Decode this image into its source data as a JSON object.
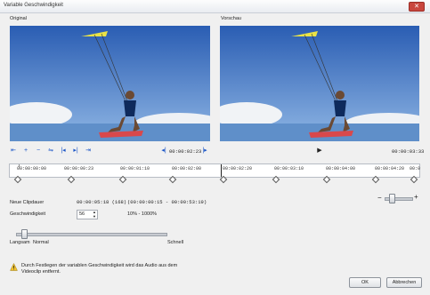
{
  "window": {
    "title": "Variable Geschwindigkeit",
    "close_icon": "close-icon"
  },
  "panels": {
    "original_label": "Original",
    "preview_label": "Vorschau"
  },
  "transport": {
    "buttons": [
      {
        "name": "mark-in-icon",
        "glyph": "⇤"
      },
      {
        "name": "add-keyframe-icon",
        "glyph": "+"
      },
      {
        "name": "remove-keyframe-icon",
        "glyph": "−"
      },
      {
        "name": "reverse-keyframe-icon",
        "glyph": "⇋"
      },
      {
        "name": "prev-keyframe-icon",
        "glyph": "|◂"
      },
      {
        "name": "next-keyframe-icon",
        "glyph": "▸|"
      },
      {
        "name": "mark-out-icon",
        "glyph": "⇥"
      }
    ],
    "left_timecode": "00:00:02:23",
    "right_timecode": "00:00:03:33",
    "prev_frame_glyph": "◂|",
    "next_frame_glyph": "|▸",
    "play_glyph": "▶"
  },
  "timeline": {
    "labels": [
      "00:00:00:00",
      "00:00:00:23",
      "00:00:01:10",
      "00:00:02:00",
      "00:00:02:20",
      "00:00:03:10",
      "00:00:04:00",
      "00:00:04:20",
      "00:0"
    ]
  },
  "zoom": {
    "minus": "−",
    "plus": "+",
    "level": 0.25
  },
  "clip": {
    "neue_clipdauer_label": "Neue Clipdauer",
    "neue_clipdauer_value": "00:00:05:18 (168)",
    "range_value": "(00:00:00:15 - 00:00:53:19)",
    "geschwindigkeit_label": "Geschwindigkeit",
    "speed_value": "56",
    "speed_range": "10% - 1000%"
  },
  "speed_slider": {
    "langsam": "Langsam",
    "normal": "Normal",
    "schnell": "Schnell",
    "level": 0.05
  },
  "warning": {
    "icon": "warning-icon",
    "text": "Durch Festlegen der variablen Geschwindigkeit wird das Audio aus dem Videoclip entfernt."
  },
  "buttons": {
    "ok": "OK",
    "cancel": "Abbrechen"
  }
}
